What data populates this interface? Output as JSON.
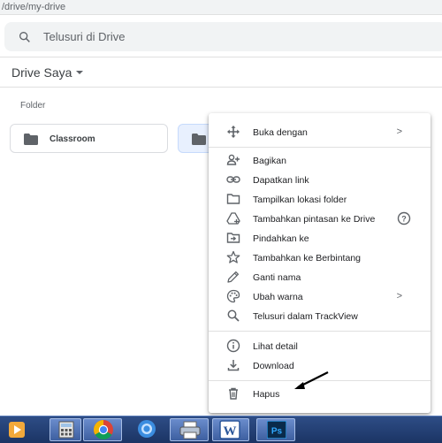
{
  "browser": {
    "url_fragment": "/drive/my-drive"
  },
  "search": {
    "placeholder": "Telusuri di Drive"
  },
  "header": {
    "title": "Drive Saya"
  },
  "section": {
    "label": "Folder"
  },
  "folders": [
    {
      "name": "Classroom",
      "selected": false
    },
    {
      "name": "",
      "selected": true
    }
  ],
  "context_menu": {
    "items": [
      {
        "label": "Buka dengan",
        "icon": "move-icon",
        "has_submenu": true
      },
      {
        "label": "Bagikan",
        "icon": "share-person-add-icon"
      },
      {
        "label": "Dapatkan link",
        "icon": "link-icon"
      },
      {
        "label": "Tampilkan lokasi folder",
        "icon": "folder-outline-icon"
      },
      {
        "label": "Tambahkan pintasan ke Drive",
        "icon": "add-shortcut-icon",
        "has_help": true
      },
      {
        "label": "Pindahkan ke",
        "icon": "move-to-folder-icon"
      },
      {
        "label": "Tambahkan ke Berbintang",
        "icon": "star-outline-icon"
      },
      {
        "label": "Ganti nama",
        "icon": "pencil-icon"
      },
      {
        "label": "Ubah warna",
        "icon": "palette-icon",
        "has_submenu": true
      },
      {
        "label": "Telusuri dalam TrackView",
        "icon": "search-icon"
      },
      {
        "label": "Lihat detail",
        "icon": "info-icon"
      },
      {
        "label": "Download",
        "icon": "download-icon"
      },
      {
        "label": "Hapus",
        "icon": "trash-icon"
      }
    ]
  },
  "taskbar": {
    "apps": [
      "media-player-icon",
      "calculator-icon",
      "chrome-icon",
      "browser-icon",
      "printer-icon",
      "word-icon",
      "photoshop-icon"
    ],
    "word_label": "W",
    "photoshop_label": "Ps"
  },
  "colors": {
    "accent": "#1a73e8",
    "selected_folder_bg": "#e8f0fe",
    "taskbar": "#1b3464"
  }
}
